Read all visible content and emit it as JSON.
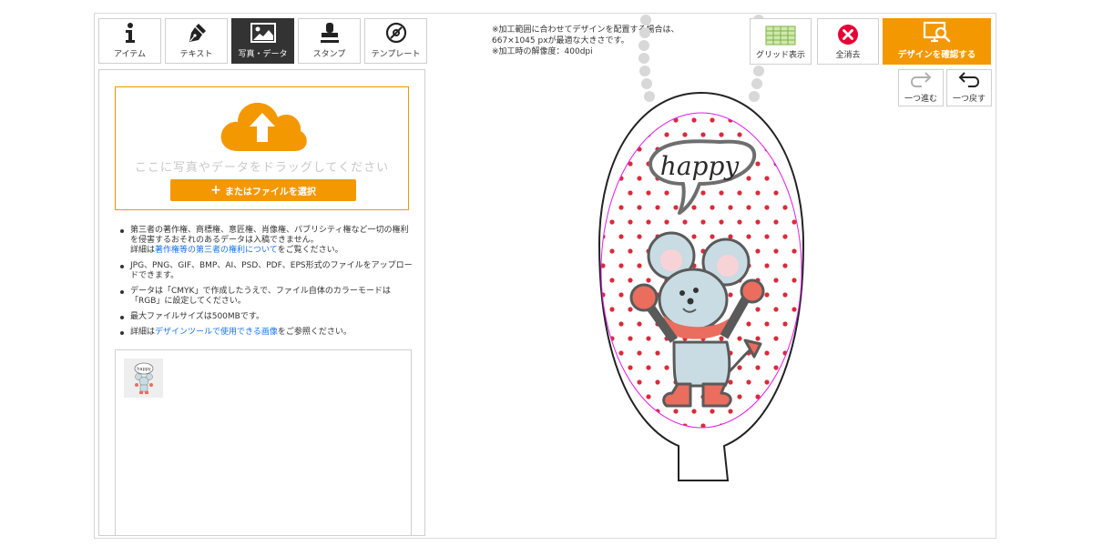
{
  "tabs": [
    {
      "label": "アイテム",
      "icon": "info-icon"
    },
    {
      "label": "テキスト",
      "icon": "pen-icon"
    },
    {
      "label": "写真・データ",
      "icon": "image-icon",
      "active": true
    },
    {
      "label": "スタンプ",
      "icon": "stamp-icon"
    },
    {
      "label": "テンプレート",
      "icon": "template-icon"
    }
  ],
  "upload": {
    "drop_text": "ここに写真やデータをドラッグしてください",
    "select_label": "またはファイルを選択",
    "upload_icon": "cloud-upload-icon"
  },
  "notes": {
    "n1_text": "第三者の著作権、商標権、意匠権、肖像権、パブリシティ権など一切の権利を侵害するおそれのあるデータは入稿できません。",
    "n1_detail_prefix": "詳細は",
    "n1_link": "著作権等の第三者の権利について",
    "n1_suffix": "をご覧ください。",
    "n2": "JPG、PNG、GIF、BMP、AI、PSD、PDF、EPS形式のファイルをアップロードできます。",
    "n3": "データは「CMYK」で作成したうえで、ファイル自体のカラーモードは「RGB」に設定してください。",
    "n4": "最大ファイルサイズは500MBです。",
    "n5_prefix": "詳細は",
    "n5_link": "デザインツールで使用できる画像",
    "n5_suffix": "をご参照ください。"
  },
  "info": {
    "line1": "※加工範囲に合わせてデザインを配置する場合は、",
    "line2": "667×1045 pxが最適な大きさです。",
    "line3": "※加工時の解像度：400dpi"
  },
  "tools": {
    "grid_label": "グリッド表示",
    "clear_label": "全消去",
    "confirm_label": "デザインを確認する",
    "redo_label": "一つ進む",
    "undo_label": "一つ戻す"
  },
  "design": {
    "speech_text": "happy"
  },
  "colors": {
    "accent": "#f39800",
    "danger": "#e60033",
    "grid_green": "#7cb342",
    "dot_red": "#d92b3a",
    "guide_magenta": "#e21ee6",
    "mouse_body": "#c9dbe3",
    "mouse_ear": "#f7d3d8",
    "mouse_limb": "#ea6d5e"
  }
}
